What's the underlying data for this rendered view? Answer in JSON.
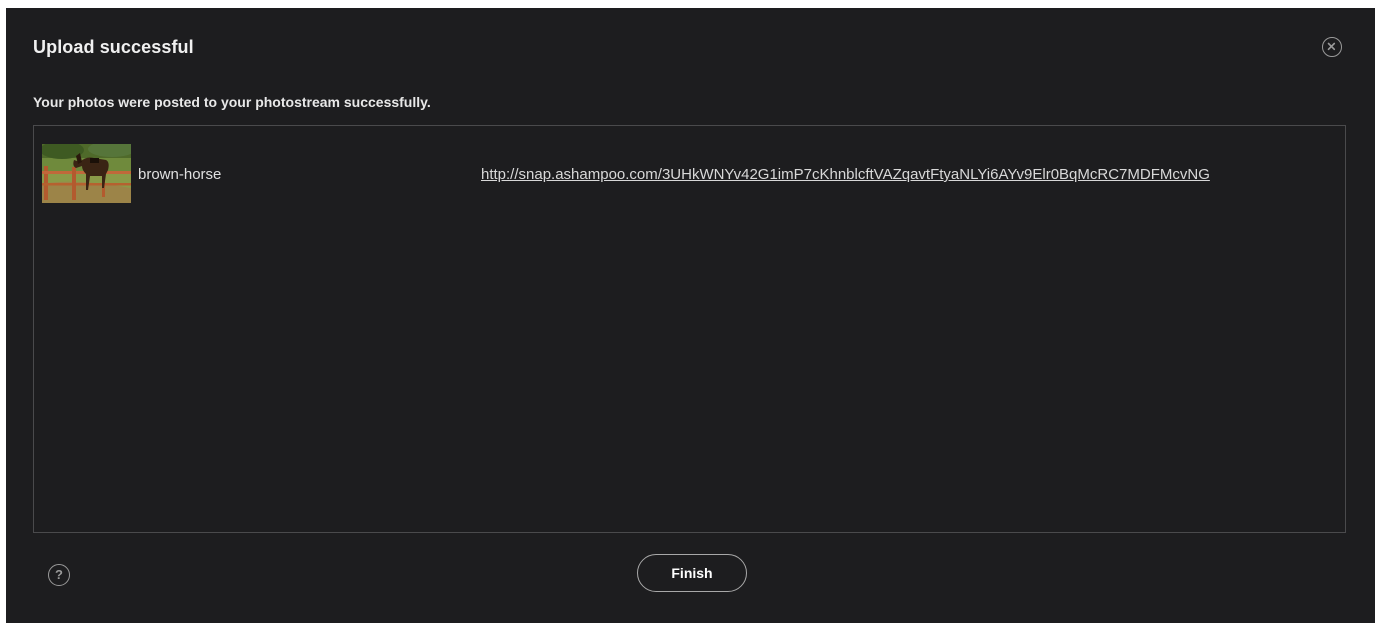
{
  "dialog": {
    "title": "Upload successful",
    "message": "Your photos were posted to your photostream successfully.",
    "close_icon": "close-circle-icon",
    "help_icon": "question-circle-icon",
    "help_label": "?",
    "finish_label": "Finish"
  },
  "uploads": [
    {
      "name": "brown-horse",
      "url": "http://snap.ashampoo.com/3UHkWNYv42G1imP7cKhnblcftVAZqavtFtyaNLYi6AYv9Elr0BqMcRC7MDFMcvNG"
    }
  ],
  "colors": {
    "background": "#1d1d1f",
    "border": "#4a4a4c",
    "text": "#e8e8e8"
  }
}
